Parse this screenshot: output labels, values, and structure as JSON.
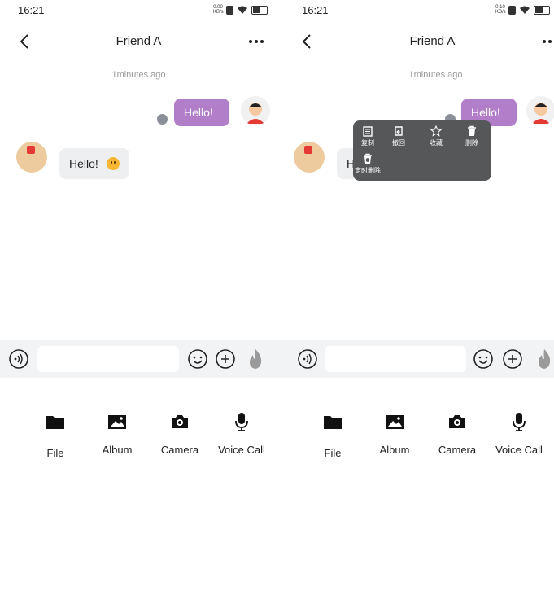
{
  "status": {
    "time": "16:21",
    "left_speed": "0.00 KB/s",
    "right_speed": "0.10 KB/s"
  },
  "chat": {
    "title": "Friend A",
    "timestamp": "1minutes ago",
    "outgoing_message": "Hello!",
    "incoming_message": "Hello!"
  },
  "input": {
    "placeholder": ""
  },
  "tools": [
    {
      "label": "File",
      "icon": "folder-icon"
    },
    {
      "label": "Album",
      "icon": "image-icon"
    },
    {
      "label": "Camera",
      "icon": "camera-icon"
    },
    {
      "label": "Voice Call",
      "icon": "microphone-icon"
    }
  ],
  "context_menu": {
    "items": [
      {
        "label": "复制",
        "icon": "copy-icon"
      },
      {
        "label": "撤回",
        "icon": "recall-icon"
      },
      {
        "label": "收藏",
        "icon": "star-icon"
      },
      {
        "label": "删除",
        "icon": "trash-icon"
      },
      {
        "label": "定时删除",
        "icon": "timed-delete-icon"
      }
    ]
  },
  "colors": {
    "outgoing_bubble": "#b37ec9",
    "menu_background": "#555759",
    "input_bar": "#f2f3f5"
  }
}
